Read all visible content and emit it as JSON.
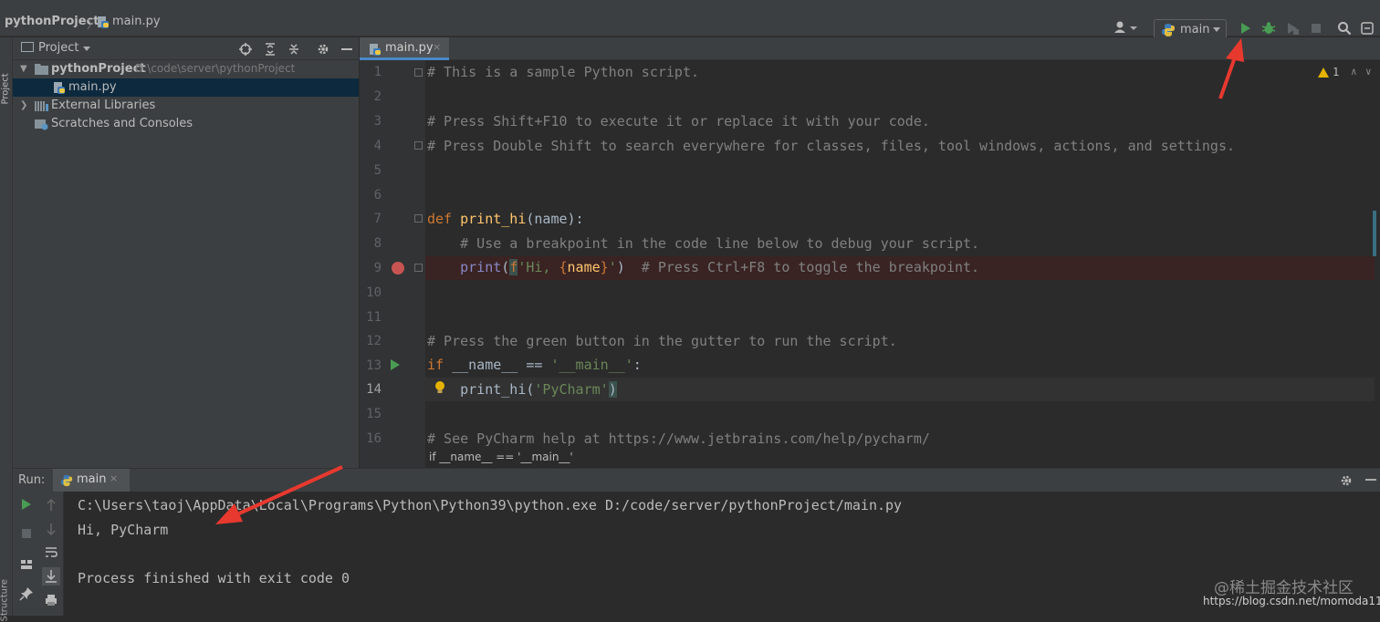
{
  "navbar": {
    "project_crumb": "pythonProject",
    "separator": "〉",
    "file_crumb": "main.py",
    "run_config": "main"
  },
  "project_panel": {
    "title": "Project",
    "tree": [
      {
        "label": "pythonProject",
        "path": "D:\\code\\server\\pythonProject"
      },
      {
        "label": "main.py"
      },
      {
        "label": "External Libraries"
      },
      {
        "label": "Scratches and Consoles"
      }
    ]
  },
  "stripe": {
    "project": "Project",
    "structure": "Structure"
  },
  "editor": {
    "tab_label": "main.py",
    "tab_close": "×",
    "warning_count": "1",
    "nav_up": "∧",
    "nav_down": "∨",
    "line_numbers": [
      "1",
      "2",
      "3",
      "4",
      "5",
      "6",
      "7",
      "8",
      "9",
      "10",
      "11",
      "12",
      "13",
      "14",
      "15",
      "16"
    ],
    "lines": {
      "l1": "# This is a sample Python script.",
      "l3": "# Press Shift+F10 to execute it or replace it with your code.",
      "l4": "# Press Double Shift to search everywhere for classes, files, tool windows, actions, and settings.",
      "l7_kw": "def ",
      "l7_fn": "print_hi",
      "l7_rest": "(name):",
      "l8": "    # Use a breakpoint in the code line below to debug your script.",
      "l9_indent": "    ",
      "l9_fn": "print",
      "l9_open": "(",
      "l9_f": "f",
      "l9_str1": "'Hi, ",
      "l9_tpl_open": "{",
      "l9_name": "name",
      "l9_tpl_close": "}",
      "l9_str2": "'",
      "l9_close": ")",
      "l9_comment": "  # Press Ctrl+F8 to toggle the breakpoint.",
      "l12": "# Press the green button in the gutter to run the script.",
      "l13_kw": "if ",
      "l13_rest": "__name__ == ",
      "l13_str": "'__main__'",
      "l13_colon": ":",
      "l14_indent": "    ",
      "l14_fn": "print_hi(",
      "l14_str": "'PyCharm'",
      "l14_close": ")",
      "l16": "# See PyCharm help at https://www.jetbrains.com/help/pycharm/"
    },
    "breadcrumb": "if __name__ == '__main__'"
  },
  "run_window": {
    "title": "Run:",
    "tab_label": "main",
    "tab_close": "×",
    "console": [
      "C:\\Users\\taoj\\AppData\\Local\\Programs\\Python\\Python39\\python.exe D:/code/server/pythonProject/main.py",
      "Hi, PyCharm",
      "",
      "Process finished with exit code 0"
    ]
  },
  "watermark": {
    "line1": "@稀土掘金技术社区",
    "line2": "https://blog.csdn.net/momoda118"
  },
  "colors": {
    "accent_run": "#499c54",
    "breakpoint": "#c75450",
    "annotation_arrow": "#e8392f"
  }
}
